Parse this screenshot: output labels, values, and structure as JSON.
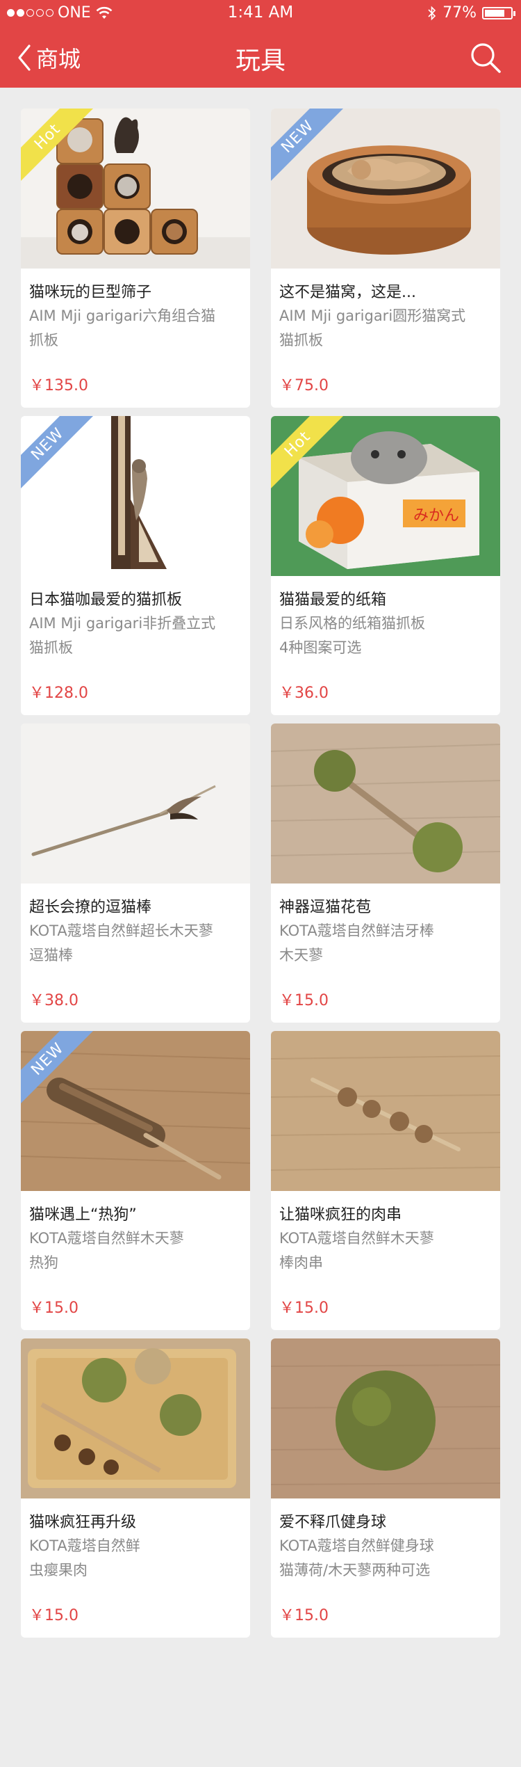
{
  "status_bar": {
    "carrier": "ONE",
    "time": "1:41 AM",
    "battery": "77%",
    "battery_level": 0.77,
    "signal_bars_filled": 2,
    "signal_bars_total": 5
  },
  "nav": {
    "back_label": "商城",
    "title": "玩具"
  },
  "colors": {
    "brand_red": "#e24545",
    "tag_hot": "#f1e14a",
    "tag_new": "#7fa6df",
    "background": "#ececec"
  },
  "products": [
    {
      "tag": "Hot",
      "title": "猫咪玩的巨型筛子",
      "subtitle": [
        "AIM Mji garigari六角组合猫",
        "抓板"
      ],
      "price": "￥135.0"
    },
    {
      "tag": "NEW",
      "title": "这不是猫窝，这是...",
      "subtitle": [
        "AIM Mji garigari圆形猫窝式",
        "猫抓板"
      ],
      "price": "￥75.0"
    },
    {
      "tag": "NEW",
      "title": "日本猫咖最爱的猫抓板",
      "subtitle": [
        "AIM Mji garigari非折叠立式",
        "猫抓板"
      ],
      "price": "￥128.0"
    },
    {
      "tag": "Hot",
      "title": "猫猫最爱的纸箱",
      "subtitle": [
        "日系风格的纸箱猫抓板",
        "4种图案可选"
      ],
      "price": "￥36.0"
    },
    {
      "tag": "",
      "title": "超长会撩的逗猫棒",
      "subtitle": [
        "KOTA蔻塔自然鲜超长木天蓼",
        "逗猫棒"
      ],
      "price": "￥38.0"
    },
    {
      "tag": "",
      "title": "神器逗猫花苞",
      "subtitle": [
        "KOTA蔻塔自然鲜洁牙棒",
        "木天蓼"
      ],
      "price": "￥15.0"
    },
    {
      "tag": "NEW",
      "title": "猫咪遇上“热狗”",
      "subtitle": [
        "KOTA蔻塔自然鲜木天蓼",
        "热狗"
      ],
      "price": "￥15.0"
    },
    {
      "tag": "",
      "title": "让猫咪疯狂的肉串",
      "subtitle": [
        "KOTA蔻塔自然鲜木天蓼",
        "棒肉串"
      ],
      "price": "￥15.0"
    },
    {
      "tag": "",
      "title": "猫咪疯狂再升级",
      "subtitle": [
        "KOTA蔻塔自然鲜",
        "虫瘿果肉"
      ],
      "price": "￥15.0"
    },
    {
      "tag": "",
      "title": "爱不释爪健身球",
      "subtitle": [
        "KOTA蔻塔自然鲜健身球",
        "猫薄荷/木天蓼两种可选"
      ],
      "price": "￥15.0"
    }
  ]
}
